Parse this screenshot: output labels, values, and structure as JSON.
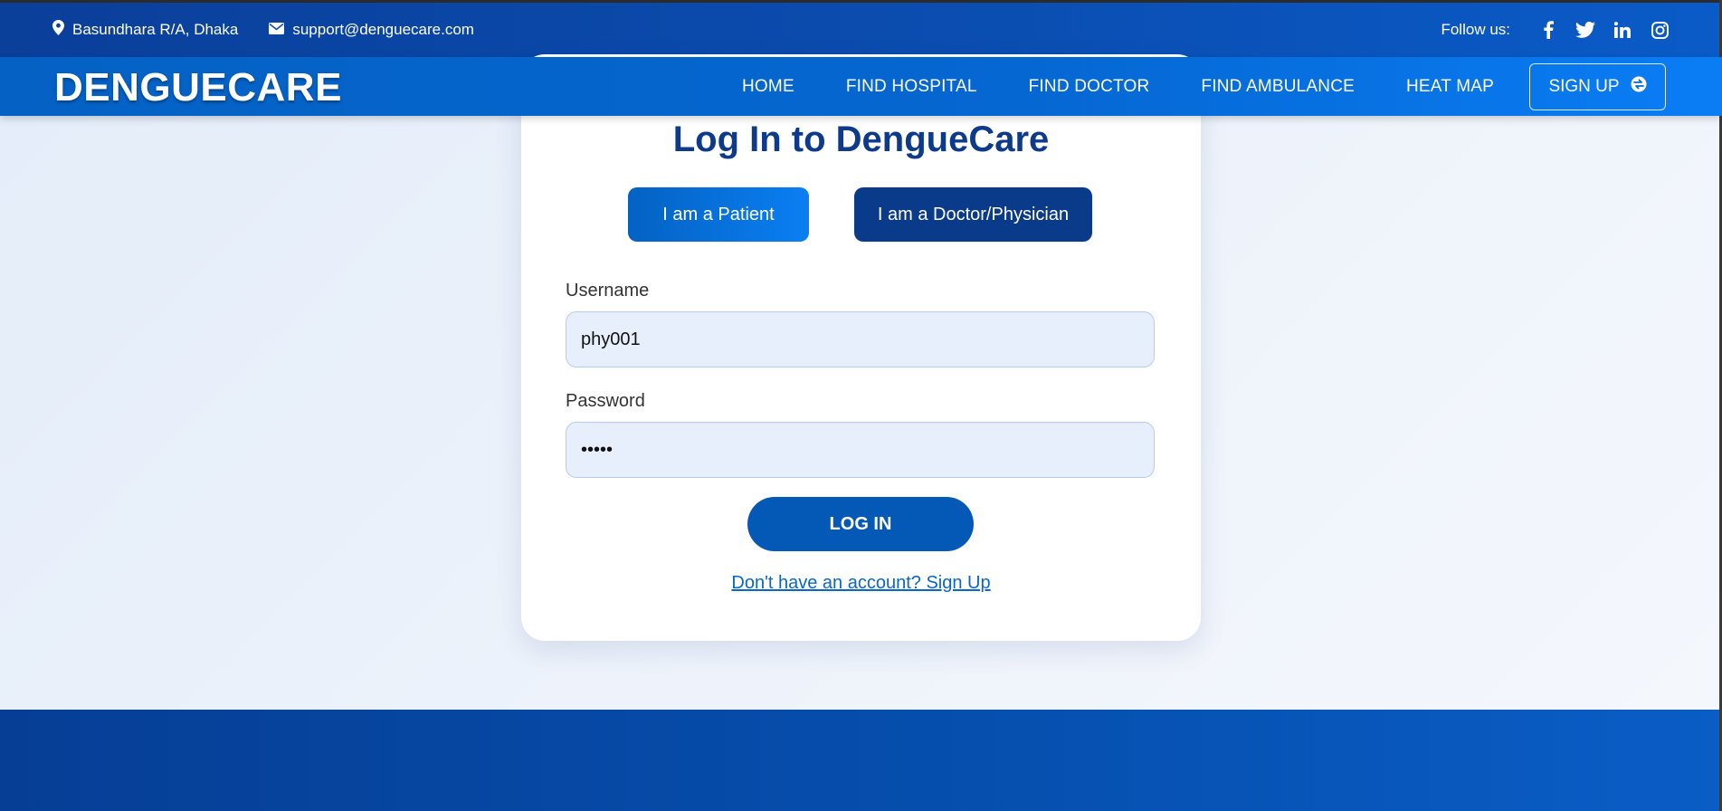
{
  "topbar": {
    "location": "Basundhara R/A, Dhaka",
    "email": "support@denguecare.com",
    "follow_label": "Follow us:",
    "social": [
      "facebook-icon",
      "twitter-icon",
      "linkedin-icon",
      "instagram-icon"
    ]
  },
  "nav": {
    "brand": "DENGUECARE",
    "links": [
      "HOME",
      "FIND HOSPITAL",
      "FIND DOCTOR",
      "FIND AMBULANCE",
      "HEAT MAP"
    ],
    "signup_label": "SIGN UP"
  },
  "login": {
    "title": "Log In to DengueCare",
    "role_patient": "I am a Patient",
    "role_doctor": "I am a Doctor/Physician",
    "username_label": "Username",
    "username_value": "phy001",
    "password_label": "Password",
    "password_value": "•••••",
    "submit_label": "LOG IN",
    "signup_link": "Don't have an account? Sign Up"
  },
  "colors": {
    "primary": "#0559b6",
    "dark_blue": "#0a3a8a",
    "title": "#0d3a8a",
    "input_bg": "#e7effc"
  }
}
